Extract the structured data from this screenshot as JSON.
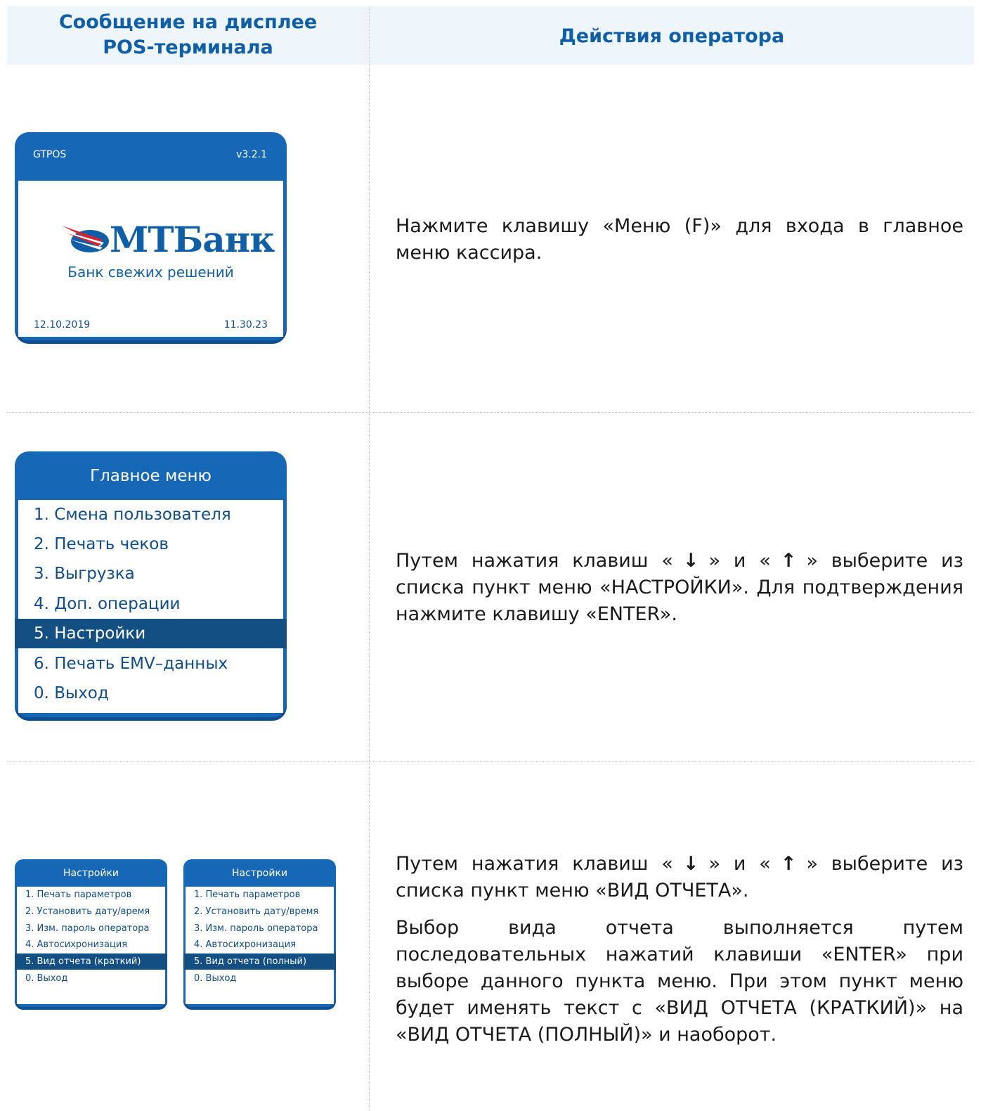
{
  "header": {
    "col1_line1": "Сообщение на дисплее",
    "col1_line2": "POS-терминала",
    "col2": "Действия оператора"
  },
  "colors": {
    "accent": "#1668b6",
    "selected": "#134f83",
    "header_bg": "#eef6fb",
    "title_text": "#0f5fa8"
  },
  "row1": {
    "screen": {
      "app_name": "GTPOS",
      "version": "v3.2.1",
      "logo_text": "МТБанк",
      "logo_icon": "bank-wing-logo-icon",
      "slogan": "Банк свежих решений",
      "date": "12.10.2019",
      "time": "11.30.23"
    },
    "action": "Нажмите клавишу «Меню (F)» для входа в главное меню кассира."
  },
  "row2": {
    "screen": {
      "title": "Главное меню",
      "items": [
        "1. Смена пользователя",
        "2. Печать чеков",
        "3. Выгрузка",
        "4. Доп. операции",
        "5. Настройки",
        "6. Печать EMV–данных",
        "0. Выход"
      ],
      "selected_index": 4
    },
    "action": {
      "part1": "Путем нажатия клавиш «",
      "down_arrow": "↓",
      "part2": "» и «",
      "up_arrow": "↑",
      "part3": "» выберите из списка пункт меню «НАСТРОЙКИ». Для подтверждения нажмите клавишу «ENTER»."
    }
  },
  "row3": {
    "screen_left": {
      "title": "Настройки",
      "items": [
        "1. Печать параметров",
        "2. Установить дату/время",
        "3. Изм. пароль оператора",
        "4. Автосихронизация",
        "5. Вид отчета (краткий)",
        "0. Выход"
      ],
      "selected_index": 4
    },
    "screen_right": {
      "title": "Настройки",
      "items": [
        "1. Печать параметров",
        "2. Установить дату/время",
        "3. Изм. пароль оператора",
        "4. Автосихронизация",
        "5. Вид отчета (полный)",
        "0. Выход"
      ],
      "selected_index": 4
    },
    "action1": {
      "part1": "Путем нажатия клавиш «",
      "down_arrow": "↓",
      "part2": "» и «",
      "up_arrow": "↑",
      "part3": "» выберите из списка пункт меню «ВИД ОТЧЕТА»."
    },
    "action2": "Выбор вида отчета выполняется путем последовательных нажатий клавиши «ENTER» при выборе данного пункта меню. При этом пункт меню будет именять текст с «ВИД ОТЧЕТА (КРАТКИЙ)» на «ВИД ОТЧЕТА (ПОЛНЫЙ)» и наоборот."
  }
}
